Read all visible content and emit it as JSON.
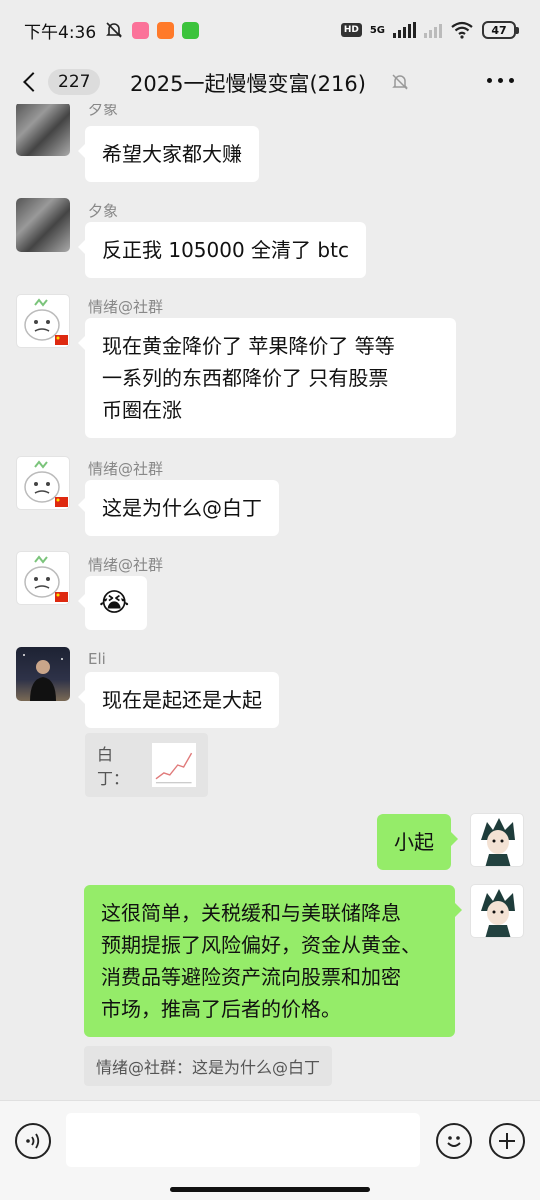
{
  "status_bar": {
    "time": "下午4:36",
    "network": "5G",
    "hd": "HD",
    "battery": "47"
  },
  "nav": {
    "unread": "227",
    "title": "2025一起慢慢变富(216)"
  },
  "messages": [
    {
      "sender": "夕象",
      "text": "希望大家都大赚"
    },
    {
      "sender": "夕象",
      "text": "反正我 105000 全清了 btc"
    },
    {
      "sender": "情绪@社群",
      "lines": [
        "现在黄金降价了 苹果降价了 等等",
        "一系列的东西都降价了 只有股票",
        "币圈在涨"
      ]
    },
    {
      "sender": "情绪@社群",
      "text": "这是为什么@白丁"
    },
    {
      "sender": "情绪@社群",
      "emoji": "😭"
    },
    {
      "sender": "Eli",
      "text": "现在是起还是大起",
      "quote": "白丁："
    },
    {
      "text": "小起"
    },
    {
      "lines": [
        "这很简单，关税缓和与美联储降息",
        "预期提振了风险偏好，资金从黄金、",
        "消费品等避险资产流向股票和加密",
        "市场，推高了后者的价格。"
      ],
      "quote": "情绪@社群：这是为什么@白丁"
    }
  ],
  "colors": {
    "background": "#ededed",
    "own_bubble": "#95ec69",
    "other_bubble": "#ffffff"
  }
}
